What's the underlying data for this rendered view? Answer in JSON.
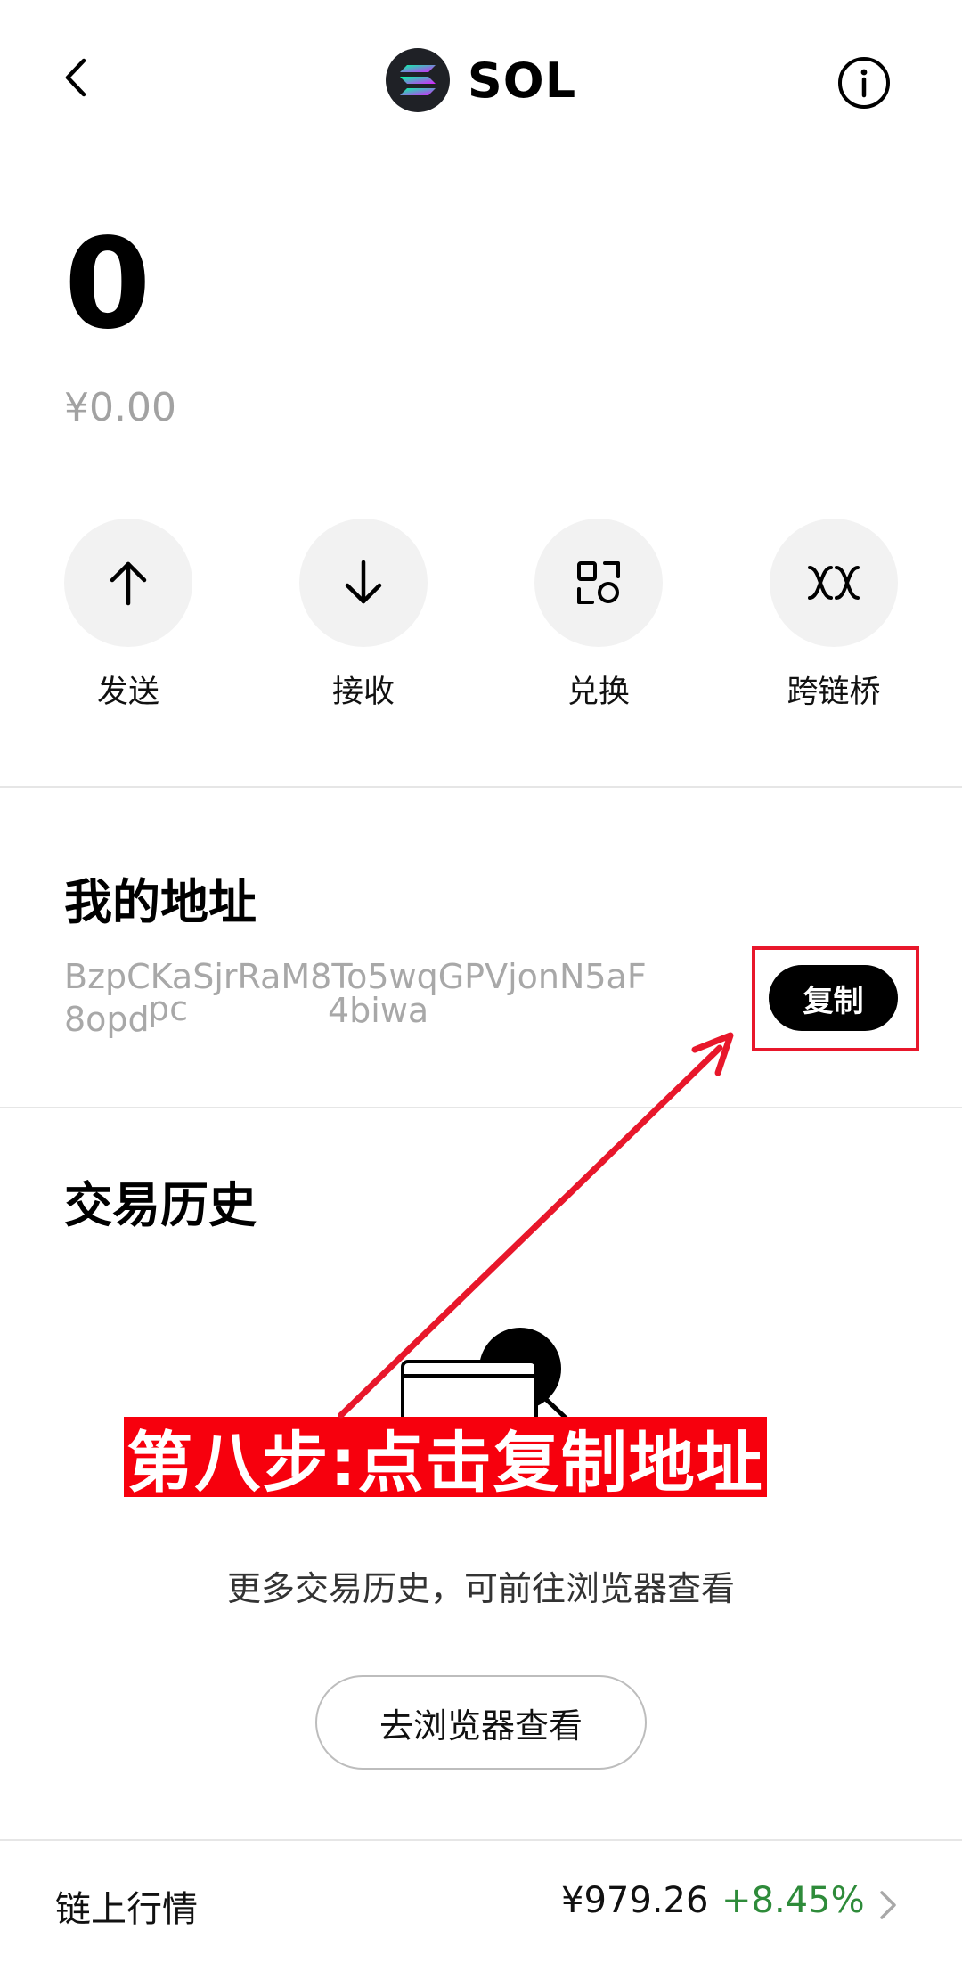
{
  "header": {
    "title": "SOL",
    "coin_icon": "solana-logo-icon",
    "back_icon": "chevron-left-icon",
    "info_icon": "info-circle-icon"
  },
  "balance": {
    "amount": "0",
    "fiat": "¥0.00"
  },
  "actions": [
    {
      "label": "发送",
      "icon": "arrow-up-icon"
    },
    {
      "label": "接收",
      "icon": "arrow-down-icon"
    },
    {
      "label": "兑换",
      "icon": "swap-icon"
    },
    {
      "label": "跨链桥",
      "icon": "bridge-icon"
    }
  ],
  "address_section": {
    "title": "我的地址",
    "address_line1": "BzpCKaSjrRaM8To5wqGPVjonN5aF",
    "address_line2": "8opd",
    "address_partial_a": "pc",
    "address_partial_b": "4biwa",
    "copy_label": "复制"
  },
  "history_section": {
    "title": "交易历史",
    "overlay_step_text": "第八步:点击复制地址",
    "hint": "更多交易历史，可前往浏览器查看",
    "explorer_button": "去浏览器查看"
  },
  "market": {
    "label": "链上行情",
    "price": "¥979.26",
    "change": "+8.45%",
    "chevron_icon": "chevron-right-icon"
  },
  "colors": {
    "annotation_red": "#e8172b",
    "positive_green": "#2e8b3a",
    "muted_gray": "#a2a2a2"
  }
}
